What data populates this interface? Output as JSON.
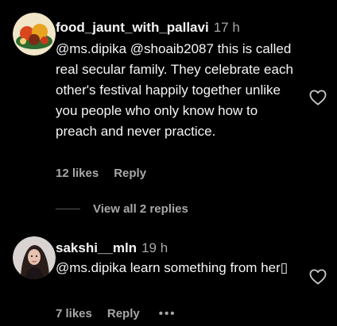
{
  "comments": [
    {
      "username": "food_jaunt_with_pallavi",
      "time": "17 h",
      "text": "@ms.dipika @shoaib2087 this is called real secular family. They celebrate each other's festival happily together unlike you people who only know how to preach and never practice.",
      "likes": "12 likes",
      "reply_label": "Reply",
      "view_replies": "View all 2 replies",
      "avatar_icon": "food-plate-avatar",
      "heart_icon": "heart-outline-icon"
    },
    {
      "username": "sakshi__mln",
      "time": "19 h",
      "text": "@ms.dipika learn something from her▯",
      "likes": "7 likes",
      "reply_label": "Reply",
      "more_label": "•••",
      "avatar_icon": "woman-avatar",
      "heart_icon": "heart-outline-icon"
    }
  ],
  "colors": {
    "background": "#000000",
    "primary_text": "#f5f5f5",
    "secondary_text": "#a8a8a8"
  }
}
